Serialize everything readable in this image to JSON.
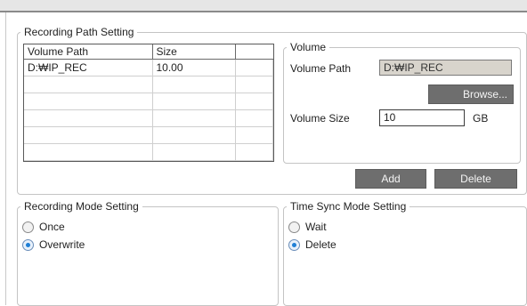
{
  "recording_path": {
    "legend": "Recording Path Setting",
    "table": {
      "columns": [
        "Volume Path",
        "Size",
        ""
      ],
      "rows": [
        [
          "D:₩IP_REC",
          "10.00",
          ""
        ],
        [
          "",
          "",
          ""
        ],
        [
          "",
          "",
          ""
        ],
        [
          "",
          "",
          ""
        ],
        [
          "",
          "",
          ""
        ],
        [
          "",
          "",
          ""
        ]
      ]
    },
    "volume": {
      "legend": "Volume",
      "path_label": "Volume Path",
      "path_value": "D:₩IP_REC",
      "browse_label": "Browse...",
      "size_label": "Volume Size",
      "size_value": "10",
      "size_unit": "GB"
    },
    "add_label": "Add",
    "delete_label": "Delete"
  },
  "recording_mode": {
    "legend": "Recording Mode Setting",
    "options": [
      {
        "label": "Once",
        "selected": false
      },
      {
        "label": "Overwrite",
        "selected": true
      }
    ]
  },
  "time_sync_mode": {
    "legend": "Time Sync Mode Setting",
    "options": [
      {
        "label": "Wait",
        "selected": false
      },
      {
        "label": "Delete",
        "selected": true
      }
    ]
  }
}
